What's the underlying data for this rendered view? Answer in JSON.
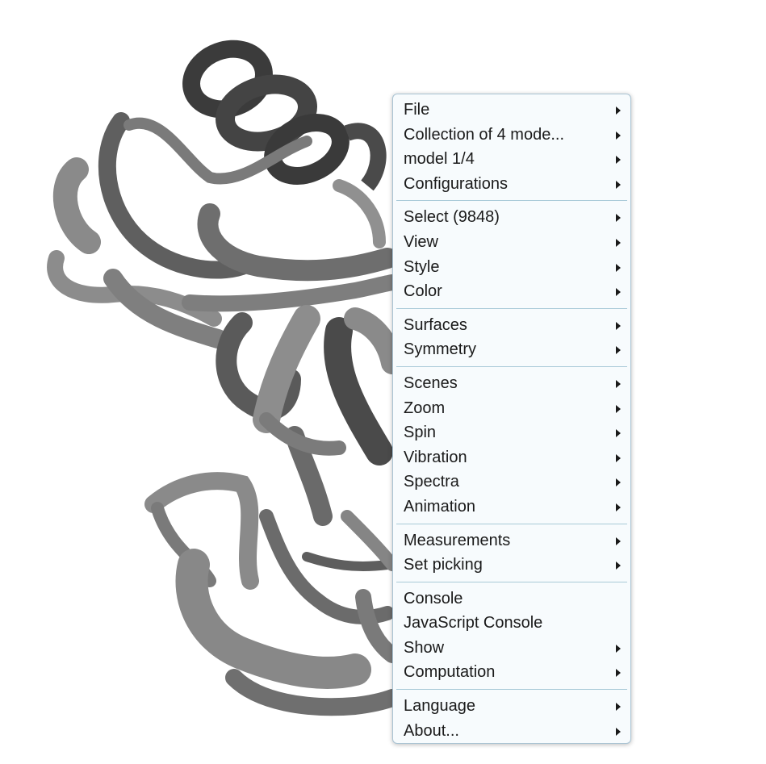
{
  "menu": {
    "groups": [
      {
        "items": [
          {
            "label": "File",
            "submenu": true
          },
          {
            "label": "Collection of 4 mode...",
            "submenu": true
          },
          {
            "label": "model 1/4",
            "submenu": true
          },
          {
            "label": "Configurations",
            "submenu": true
          }
        ]
      },
      {
        "items": [
          {
            "label": "Select (9848)",
            "submenu": true
          },
          {
            "label": "View",
            "submenu": true
          },
          {
            "label": "Style",
            "submenu": true
          },
          {
            "label": "Color",
            "submenu": true
          }
        ]
      },
      {
        "items": [
          {
            "label": "Surfaces",
            "submenu": true
          },
          {
            "label": "Symmetry",
            "submenu": true
          }
        ]
      },
      {
        "items": [
          {
            "label": "Scenes",
            "submenu": true
          },
          {
            "label": "Zoom",
            "submenu": true
          },
          {
            "label": "Spin",
            "submenu": true
          },
          {
            "label": "Vibration",
            "submenu": true
          },
          {
            "label": "Spectra",
            "submenu": true
          },
          {
            "label": "Animation",
            "submenu": true
          }
        ]
      },
      {
        "items": [
          {
            "label": "Measurements",
            "submenu": true
          },
          {
            "label": "Set picking",
            "submenu": true
          }
        ]
      },
      {
        "items": [
          {
            "label": "Console",
            "submenu": false
          },
          {
            "label": "JavaScript Console",
            "submenu": false
          },
          {
            "label": "Show",
            "submenu": true
          },
          {
            "label": "Computation",
            "submenu": true
          }
        ]
      },
      {
        "items": [
          {
            "label": "Language",
            "submenu": true
          },
          {
            "label": "About...",
            "submenu": true
          }
        ]
      }
    ]
  },
  "colors": {
    "menu_background": "#f7fbfd",
    "menu_border": "#a9c3d3",
    "separator": "#a9cad8",
    "ribbon_light": "#8f8f8f",
    "ribbon_mid": "#727272",
    "ribbon_dark": "#3e3e3e"
  }
}
